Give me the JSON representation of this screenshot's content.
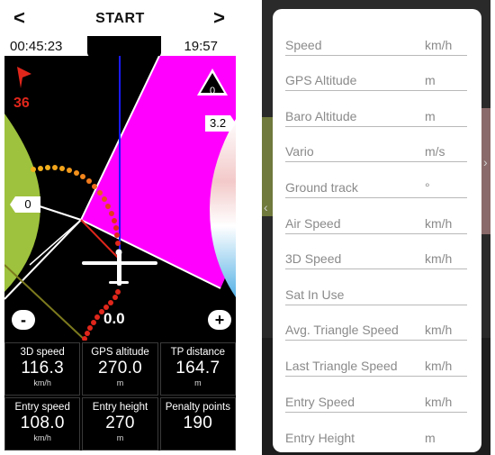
{
  "left": {
    "nav": {
      "prev": "<",
      "title": "START",
      "next": ">"
    },
    "time_left": "00:45:23",
    "time_right": "19:57",
    "map": {
      "wind_value": "36",
      "triangle_value": "0",
      "tag_right": "3.2",
      "tag_left": "0",
      "speed": "0.0",
      "zoom_out": "-",
      "zoom_in": "+",
      "colors": {
        "sector": "#ff00ff",
        "left_arc": "#9ec23d",
        "track_dots": "#e0261b",
        "vario_line": "#1a1aff"
      },
      "icons": [
        "wind-arrow-icon",
        "triangle-icon",
        "glider-icon"
      ]
    },
    "grid": [
      {
        "label": "3D speed",
        "value": "116.3",
        "unit": "km/h"
      },
      {
        "label": "GPS altitude",
        "value": "270.0",
        "unit": "m"
      },
      {
        "label": "TP distance",
        "value": "164.7",
        "unit": "m"
      },
      {
        "label": "Entry speed",
        "value": "108.0",
        "unit": "km/h"
      },
      {
        "label": "Entry height",
        "value": "270",
        "unit": "m"
      },
      {
        "label": "Penalty points",
        "value": "190",
        "unit": ""
      }
    ]
  },
  "right": {
    "rows": [
      {
        "label": "Speed",
        "unit": "km/h"
      },
      {
        "label": "GPS Altitude",
        "unit": "m"
      },
      {
        "label": "Baro Altitude",
        "unit": "m"
      },
      {
        "label": "Vario",
        "unit": "m/s"
      },
      {
        "label": "Ground track",
        "unit": "°"
      },
      {
        "label": "Air Speed",
        "unit": "km/h"
      },
      {
        "label": "3D Speed",
        "unit": "km/h"
      },
      {
        "label": "Sat In Use",
        "unit": ""
      },
      {
        "label": "Avg. Triangle Speed",
        "unit": "km/h"
      },
      {
        "label": "Last Triangle Speed",
        "unit": "km/h"
      },
      {
        "label": "Entry Speed",
        "unit": "km/h"
      },
      {
        "label": "Entry Height",
        "unit": "m"
      }
    ]
  }
}
